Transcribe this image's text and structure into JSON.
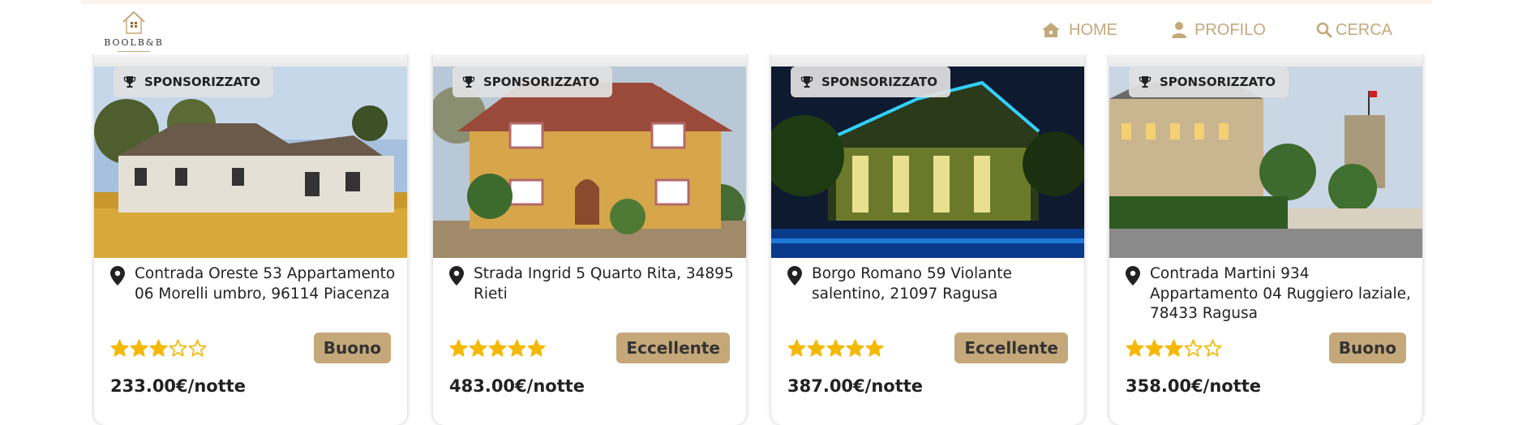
{
  "header": {
    "logo_text": "BOOLB&B",
    "nav": [
      {
        "label": "HOME"
      },
      {
        "label": "PROFILO"
      },
      {
        "label": "CERCA"
      }
    ]
  },
  "colors": {
    "accent": "#c5a87a",
    "star": "#f5b800"
  },
  "listings": [
    {
      "badge": "SPONSORIZZATO",
      "address": "Contrada Oreste 53 Appartamento 06 Morelli umbro, 96114 Piacenza",
      "stars": 3,
      "max_stars": 5,
      "rating_label": "Buono",
      "price": "233.00€/notte"
    },
    {
      "badge": "SPONSORIZZATO",
      "address": "Strada Ingrid 5 Quarto Rita, 34895 Rieti",
      "stars": 5,
      "max_stars": 5,
      "rating_label": "Eccellente",
      "price": "483.00€/notte"
    },
    {
      "badge": "SPONSORIZZATO",
      "address": "Borgo Romano 59 Violante salentino, 21097 Ragusa",
      "stars": 5,
      "max_stars": 5,
      "rating_label": "Eccellente",
      "price": "387.00€/notte"
    },
    {
      "badge": "SPONSORIZZATO",
      "address": "Contrada Martini 934 Appartamento 04 Ruggiero laziale, 78433 Ragusa",
      "stars": 3,
      "max_stars": 5,
      "rating_label": "Buono",
      "price": "358.00€/notte"
    }
  ]
}
